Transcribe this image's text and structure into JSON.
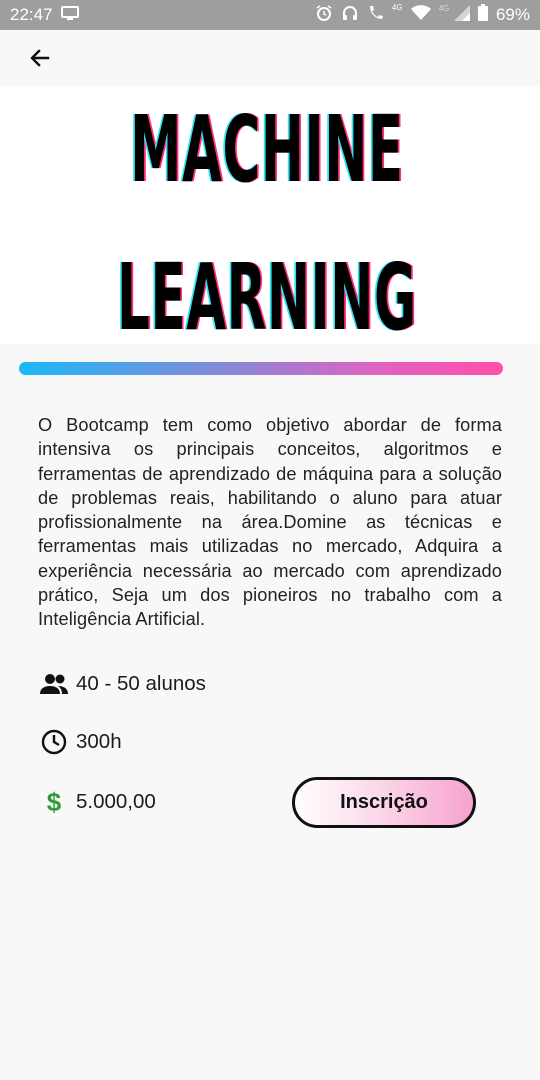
{
  "status_bar": {
    "time": "22:47",
    "battery": "69%",
    "network_label_1": "4G",
    "network_label_2": "4G",
    "icons": [
      "screen-icon",
      "alarm-icon",
      "headset-icon",
      "call-icon",
      "wifi-icon",
      "signal-icon",
      "battery-icon"
    ]
  },
  "app_bar": {
    "back_icon": "arrow-left-icon"
  },
  "hero": {
    "line1": "MACHINE",
    "line2": "LEARNING"
  },
  "accent_gradient": [
    "#1ab8f7",
    "#8f86d6",
    "#ff4fab"
  ],
  "description": "O Bootcamp tem como objetivo abordar de forma intensiva os principais conceitos, algoritmos e ferramentas de aprendizado de máquina para a solução de problemas reais, habilitando o aluno para atuar profissionalmente na área.Domine as técnicas e ferramentas mais utilizadas no mercado, Adquira a experiência necessária ao mercado com aprendizado prático, Seja um dos pioneiros no trabalho com a Inteligência Artificial.",
  "info": {
    "students": {
      "icon": "people-icon",
      "text": "40 - 50 alunos"
    },
    "hours": {
      "icon": "clock-icon",
      "text": "300h"
    },
    "price": {
      "icon": "dollar-icon",
      "symbol": "$",
      "text": "5.000,00",
      "color": "#2e9b3b"
    }
  },
  "actions": {
    "enroll_label": "Inscrição"
  }
}
